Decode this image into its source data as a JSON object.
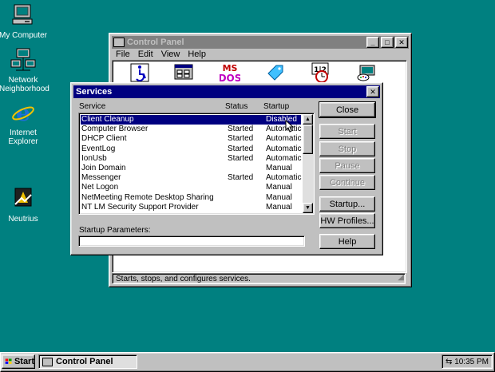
{
  "desktop": {
    "icons": [
      {
        "label": "My Computer"
      },
      {
        "label": "Network Neighborhood"
      },
      {
        "label": "Internet Explorer"
      },
      {
        "label": "Neutrius"
      }
    ]
  },
  "control_panel": {
    "title": "Control Panel",
    "menu": [
      "File",
      "Edit",
      "View",
      "Help"
    ],
    "status_text": "Starts, stops, and configures services.",
    "applet_icons": [
      "accessibility-icon",
      "add-remove-programs-icon",
      "msdos-console-icon",
      "tag-icon",
      "date-time-icon",
      "display-icon"
    ]
  },
  "services": {
    "title": "Services",
    "col_service": "Service",
    "col_status": "Status",
    "col_startup": "Startup",
    "rows": [
      {
        "name": "Client Cleanup",
        "status": "",
        "startup": "Disabled"
      },
      {
        "name": "Computer Browser",
        "status": "Started",
        "startup": "Automatic"
      },
      {
        "name": "DHCP Client",
        "status": "Started",
        "startup": "Automatic"
      },
      {
        "name": "EventLog",
        "status": "Started",
        "startup": "Automatic"
      },
      {
        "name": "IonUsb",
        "status": "Started",
        "startup": "Automatic"
      },
      {
        "name": "Join Domain",
        "status": "",
        "startup": "Manual"
      },
      {
        "name": "Messenger",
        "status": "Started",
        "startup": "Automatic"
      },
      {
        "name": "Net Logon",
        "status": "",
        "startup": "Manual"
      },
      {
        "name": "NetMeeting Remote Desktop Sharing",
        "status": "",
        "startup": "Manual"
      },
      {
        "name": "NT LM Security Support Provider",
        "status": "",
        "startup": "Manual"
      }
    ],
    "startup_params_label": "Startup Parameters:",
    "startup_params_value": "",
    "buttons": {
      "close": "Close",
      "start": "Start",
      "stop": "Stop",
      "pause": "Pause",
      "continue": "Continue",
      "startup": "Startup...",
      "hw_profiles": "HW Profiles...",
      "help": "Help"
    }
  },
  "taskbar": {
    "start_label": "Start",
    "task_label": "Control Panel",
    "clock": "10:35 PM"
  },
  "colors": {
    "desktop": "#008080",
    "title_active": "#000080",
    "title_inactive": "#808080",
    "face": "#c0c0c0"
  }
}
